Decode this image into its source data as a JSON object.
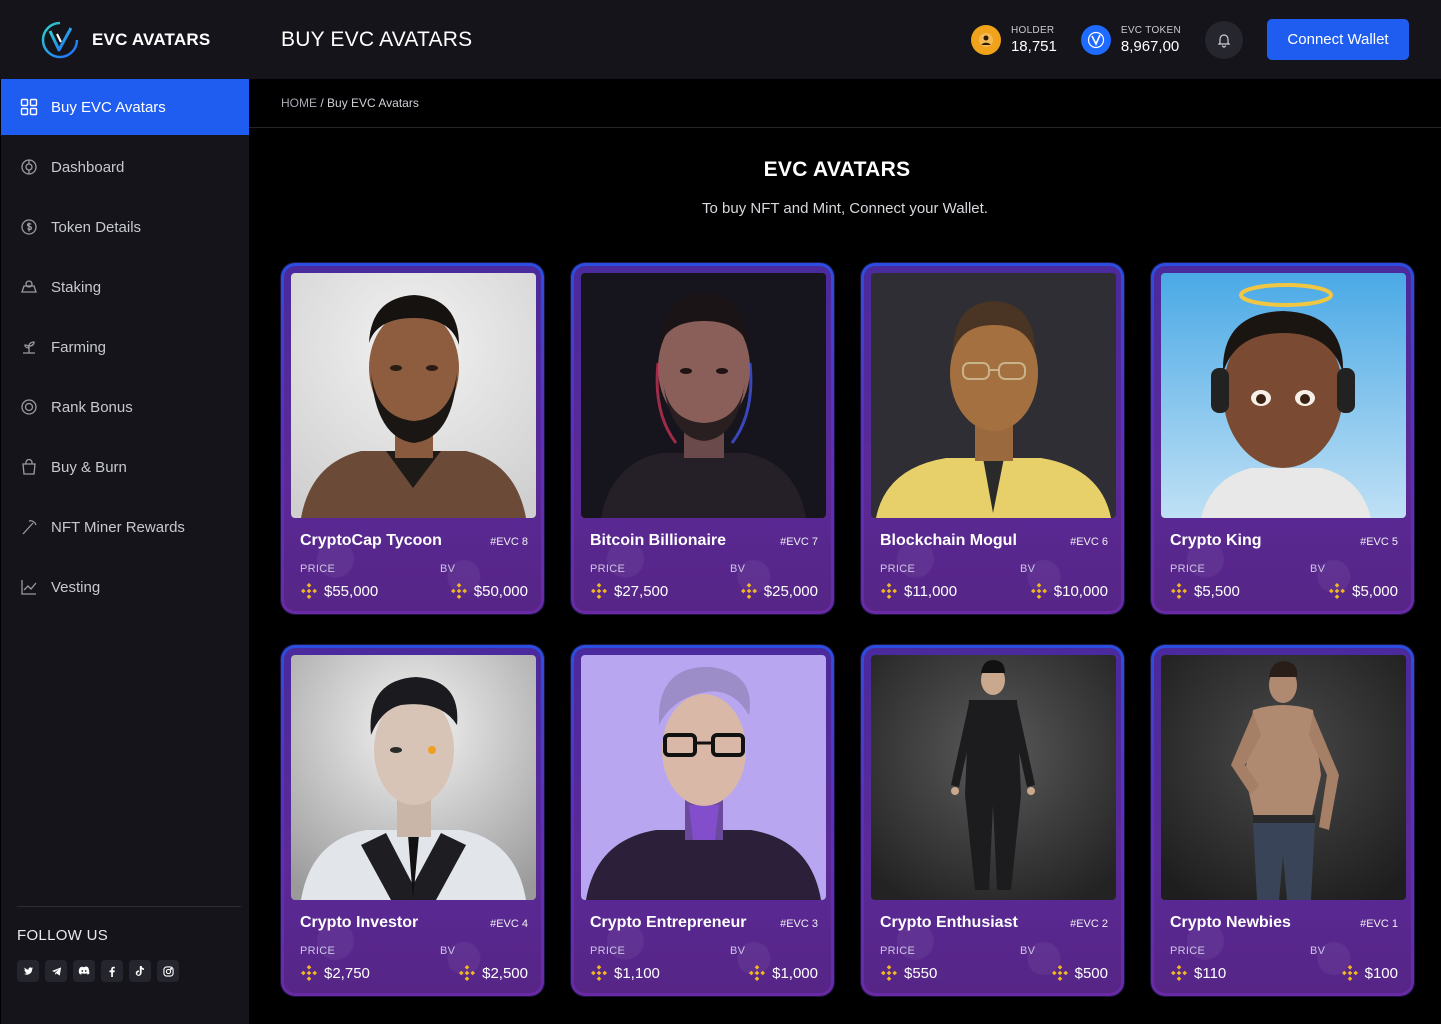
{
  "brand": {
    "name": "EVC AVATARS"
  },
  "header": {
    "title": "BUY EVC AVATARS",
    "holder_label": "HOLDER",
    "holder_value": "18,751",
    "token_label": "EVC TOKEN",
    "token_value": "8,967,00",
    "connect_label": "Connect Wallet"
  },
  "sidebar": {
    "items": [
      {
        "label": "Buy EVC Avatars",
        "icon": "grid-icon"
      },
      {
        "label": "Dashboard",
        "icon": "dashboard-icon"
      },
      {
        "label": "Token Details",
        "icon": "coin-icon"
      },
      {
        "label": "Staking",
        "icon": "staking-icon"
      },
      {
        "label": "Farming",
        "icon": "farming-icon"
      },
      {
        "label": "Rank Bonus",
        "icon": "rank-icon"
      },
      {
        "label": "Buy & Burn",
        "icon": "bag-icon"
      },
      {
        "label": "NFT Miner Rewards",
        "icon": "pickaxe-icon"
      },
      {
        "label": "Vesting",
        "icon": "chart-line-icon"
      }
    ],
    "follow_title": "FOLLOW US",
    "socials": [
      "twitter-icon",
      "telegram-icon",
      "discord-icon",
      "facebook-icon",
      "tiktok-icon",
      "instagram-icon"
    ]
  },
  "breadcrumb": {
    "home": "HOME",
    "separator": " / ",
    "current": "Buy EVC Avatars"
  },
  "section": {
    "title": "EVC AVATARS",
    "subtitle": "To buy NFT and Mint, Connect your Wallet."
  },
  "cards": [
    {
      "name": "CryptoCap Tycoon",
      "id": "#EVC 8",
      "price_label": "PRICE",
      "price": "$55,000",
      "bv_label": "BV",
      "bv": "$50,000"
    },
    {
      "name": "Bitcoin Billionaire",
      "id": "#EVC 7",
      "price_label": "PRICE",
      "price": "$27,500",
      "bv_label": "BV",
      "bv": "$25,000"
    },
    {
      "name": "Blockchain Mogul",
      "id": "#EVC 6",
      "price_label": "PRICE",
      "price": "$11,000",
      "bv_label": "BV",
      "bv": "$10,000"
    },
    {
      "name": "Crypto King",
      "id": "#EVC 5",
      "price_label": "PRICE",
      "price": "$5,500",
      "bv_label": "BV",
      "bv": "$5,000"
    },
    {
      "name": "Crypto Investor",
      "id": "#EVC 4",
      "price_label": "PRICE",
      "price": "$2,750",
      "bv_label": "BV",
      "bv": "$2,500"
    },
    {
      "name": "Crypto Entrepreneur",
      "id": "#EVC 3",
      "price_label": "PRICE",
      "price": "$1,100",
      "bv_label": "BV",
      "bv": "$1,000"
    },
    {
      "name": "Crypto Enthusiast",
      "id": "#EVC 2",
      "price_label": "PRICE",
      "price": "$550",
      "bv_label": "BV",
      "bv": "$500"
    },
    {
      "name": "Crypto Newbies",
      "id": "#EVC 1",
      "price_label": "PRICE",
      "price": "$110",
      "bv_label": "BV",
      "bv": "$100"
    }
  ],
  "colors": {
    "accent": "#1f5cf0",
    "sidebar_bg": "#14141a",
    "card_purple": "#5b2a98",
    "coin_gold": "#f3b81f"
  }
}
